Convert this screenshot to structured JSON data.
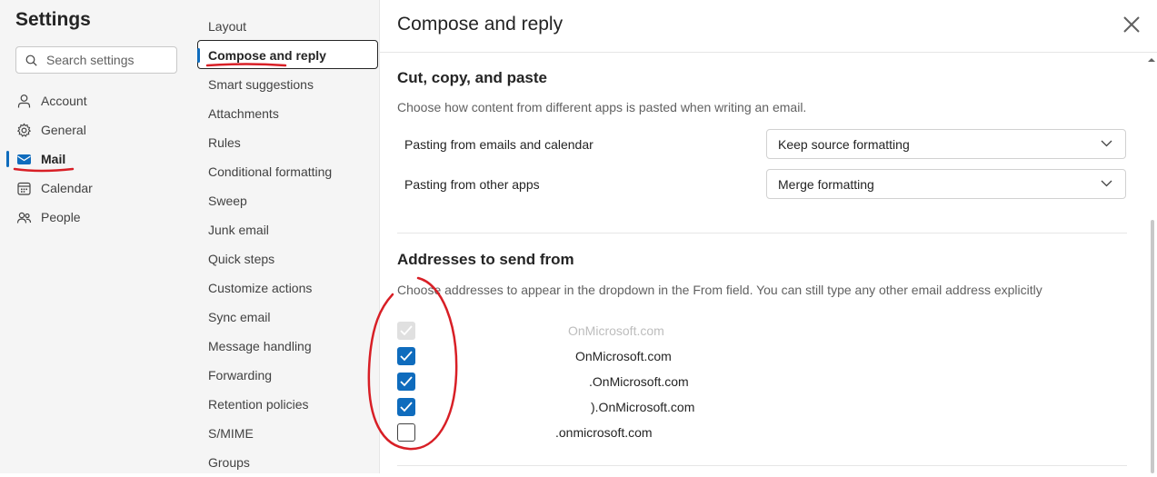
{
  "left_nav": {
    "title": "Settings",
    "search_placeholder": "Search settings",
    "categories": [
      {
        "label": "Account",
        "icon": "person-icon"
      },
      {
        "label": "General",
        "icon": "gear-icon"
      },
      {
        "label": "Mail",
        "icon": "mail-icon",
        "active": true
      },
      {
        "label": "Calendar",
        "icon": "calendar-icon"
      },
      {
        "label": "People",
        "icon": "people-icon"
      }
    ]
  },
  "sub_nav": {
    "items": [
      "Layout",
      "Compose and reply",
      "Smart suggestions",
      "Attachments",
      "Rules",
      "Conditional formatting",
      "Sweep",
      "Junk email",
      "Quick steps",
      "Customize actions",
      "Sync email",
      "Message handling",
      "Forwarding",
      "Retention policies",
      "S/MIME",
      "Groups"
    ],
    "active": "Compose and reply"
  },
  "main": {
    "title": "Compose and reply",
    "cut_copy_paste": {
      "title": "Cut, copy, and paste",
      "description": "Choose how content from different apps is pasted when writing an email.",
      "rows": [
        {
          "label": "Pasting from emails and calendar",
          "value": "Keep source formatting"
        },
        {
          "label": "Pasting from other apps",
          "value": "Merge formatting"
        }
      ]
    },
    "addresses": {
      "title": "Addresses to send from",
      "description": "Choose addresses to appear in the dropdown in the From field. You can still type any other email address explicitly",
      "items": [
        {
          "text": "OnMicrosoft.com",
          "state": "disabled"
        },
        {
          "text": "OnMicrosoft.com",
          "state": "checked"
        },
        {
          "text": ".OnMicrosoft.com",
          "state": "checked"
        },
        {
          "text": ").OnMicrosoft.com",
          "state": "checked"
        },
        {
          "text": ".onmicrosoft.com",
          "state": "unchecked"
        }
      ]
    }
  },
  "colors": {
    "accent": "#0f6cbd",
    "annotation": "#d81f26",
    "nav_bg": "#f5f5f5"
  }
}
